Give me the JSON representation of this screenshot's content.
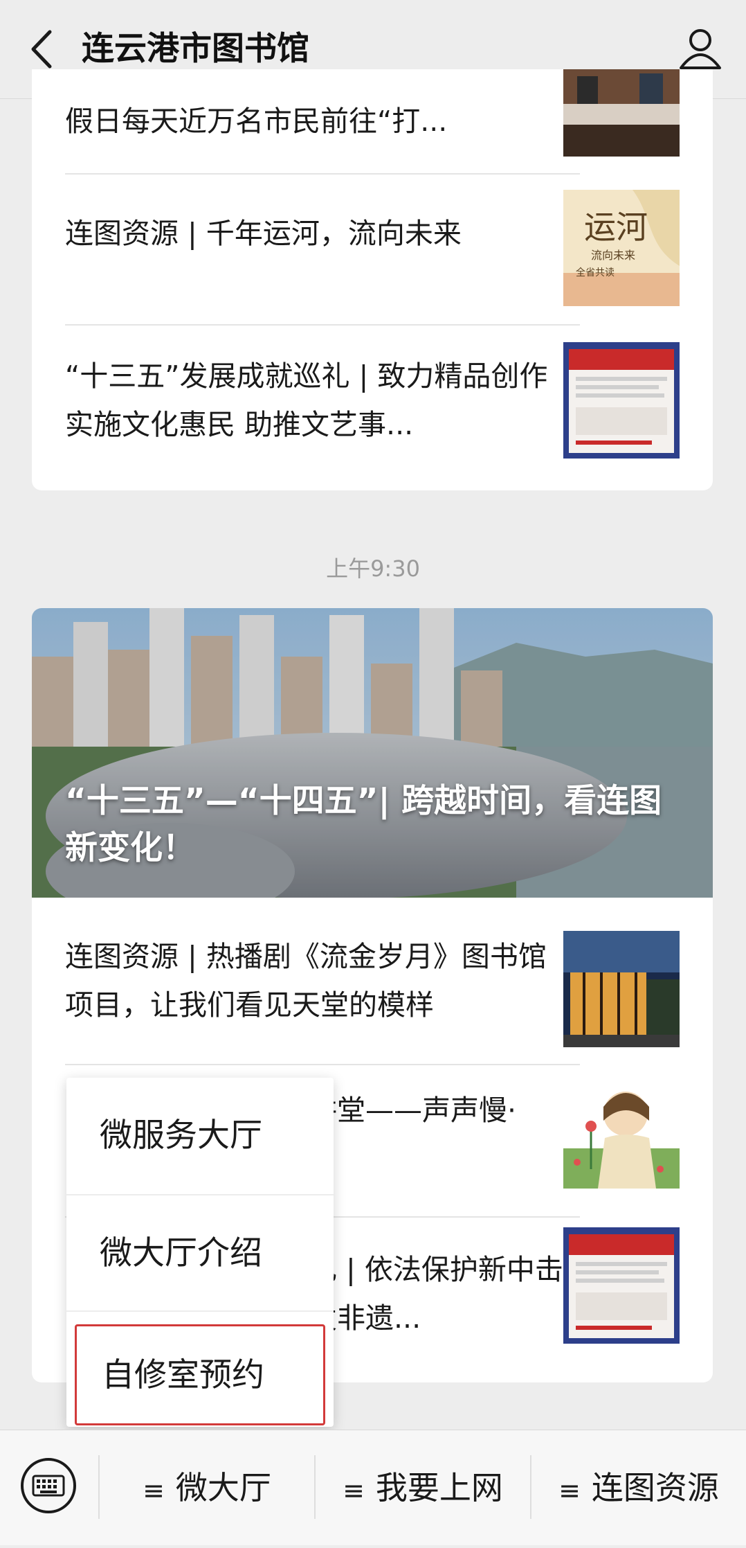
{
  "header": {
    "title": "连云港市图书馆",
    "back_icon": "chevron-left-icon",
    "profile_icon": "person-icon"
  },
  "feed": {
    "card1": {
      "articles": [
        {
          "title": "假日每天近万名市民前往“打..."
        },
        {
          "title": "连图资源 | 千年运河，流向未来"
        },
        {
          "title": "“十三五”发展成就巡礼 | 致力精品创作 实施文化惠民 助推文艺事..."
        }
      ]
    },
    "timestamp": "上午9:30",
    "card2": {
      "banner_title": "“十三五”—“十四五”| 跨越时间，看连图新变化！",
      "articles": [
        {
          "title": "连图资源 | 热播剧《流金岁月》图书馆项目，让我们看见天堂的模样"
        },
        {
          "title": "讲堂——声声慢·"
        },
        {
          "title": "礼 | 依法保护新中击发非遗..."
        }
      ]
    },
    "thumb_texts": {
      "canal_main": "运河",
      "canal_sub": "流向未来",
      "canal_foot": "全省共读"
    }
  },
  "popup_menu": {
    "items": [
      {
        "label": "微服务大厅"
      },
      {
        "label": "微大厅介绍"
      },
      {
        "label": "自修室预约"
      }
    ],
    "highlight_color": "#d23a3a"
  },
  "bottom_bar": {
    "keyboard_icon": "keyboard-icon",
    "menu_glyph": "≡",
    "tabs": [
      {
        "label": "微大厅"
      },
      {
        "label": "我要上网"
      },
      {
        "label": "连图资源"
      }
    ]
  }
}
